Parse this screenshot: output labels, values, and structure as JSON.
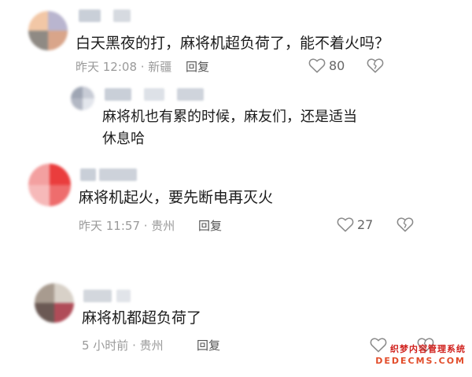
{
  "comments": [
    {
      "text": "白天黑夜的打，麻将机超负荷了，能不着火吗？",
      "meta": "昨天 12:08 · 新疆",
      "reply_label": "回复",
      "likes": "80"
    },
    {
      "text_line1": "麻将机也有累的时候，麻友们，还是适当",
      "text_line2": "休息哈"
    },
    {
      "text": "麻将机起火，要先断电再灭火",
      "meta": "昨天 11:57 · 贵州",
      "reply_label": "回复",
      "likes": "27"
    },
    {
      "text": "麻将机都超负荷了",
      "meta": "5 小时前 · 贵州",
      "reply_label": "回复"
    }
  ],
  "icons": {
    "like": "heart-outline-icon",
    "dislike": "broken-heart-icon"
  },
  "watermark": {
    "line1": "织梦内容管理系统",
    "line2": "DEDECMS.COM"
  },
  "colors": {
    "text": "#1c1c1c",
    "meta": "#9a9a9a",
    "icon": "#8a8a8a",
    "watermark_red": "#d0201c"
  }
}
